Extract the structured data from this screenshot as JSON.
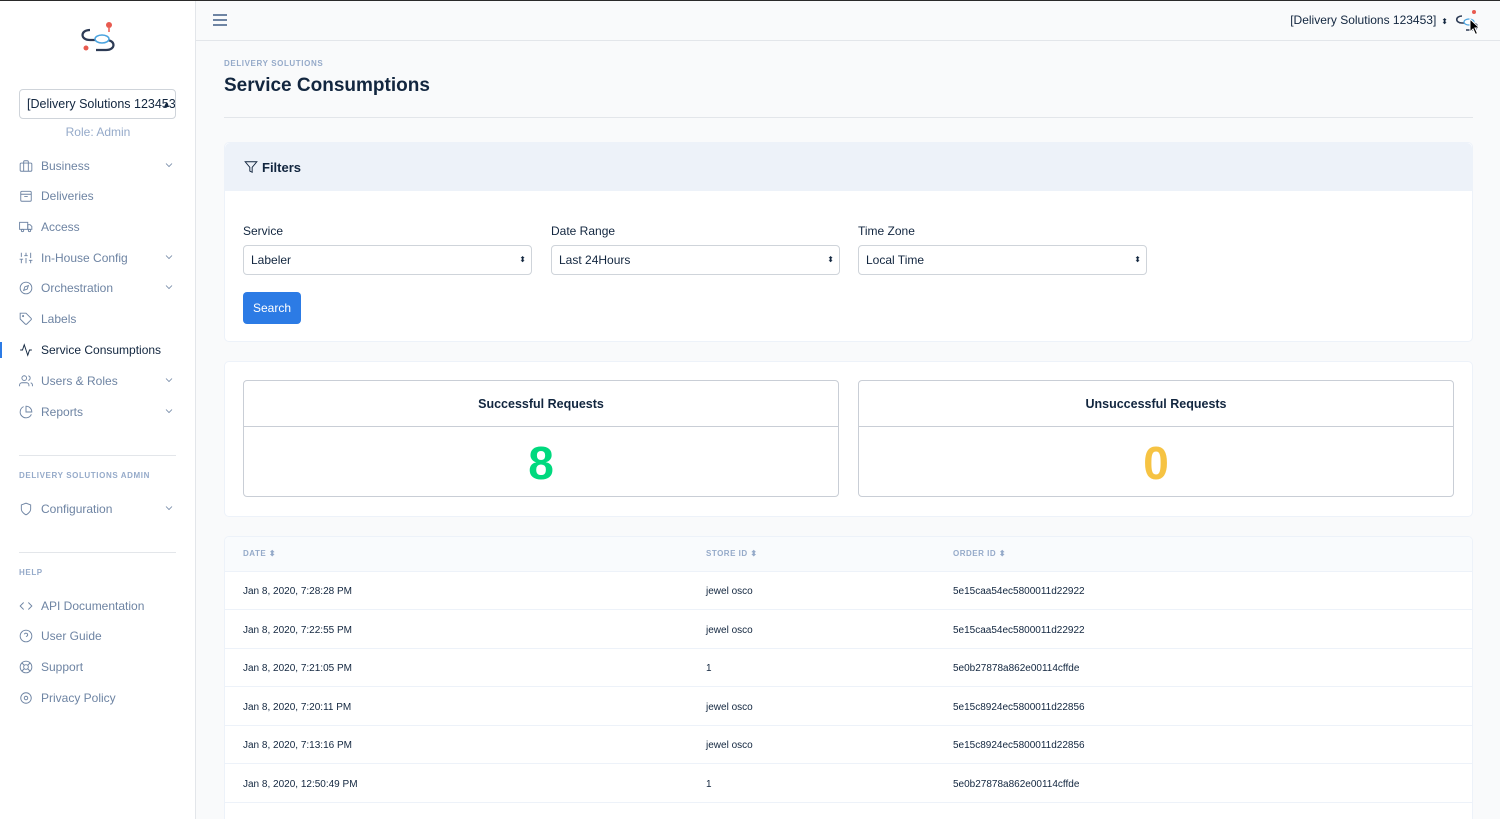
{
  "account_selector": {
    "value": "[Delivery Solutions 123453]"
  },
  "role": "Role: Admin",
  "nav": {
    "items": [
      {
        "label": "Business",
        "icon": "briefcase-icon",
        "chevron": true
      },
      {
        "label": "Deliveries",
        "icon": "package-icon",
        "chevron": false
      },
      {
        "label": "Access",
        "icon": "truck-icon",
        "chevron": false
      },
      {
        "label": "In-House Config",
        "icon": "sliders-icon",
        "chevron": true
      },
      {
        "label": "Orchestration",
        "icon": "compass-icon",
        "chevron": true
      },
      {
        "label": "Labels",
        "icon": "tag-icon",
        "chevron": false
      },
      {
        "label": "Service Consumptions",
        "icon": "activity-icon",
        "chevron": false,
        "active": true
      },
      {
        "label": "Users & Roles",
        "icon": "users-icon",
        "chevron": true
      },
      {
        "label": "Reports",
        "icon": "pie-chart-icon",
        "chevron": true
      }
    ],
    "admin_heading": "DELIVERY SOLUTIONS ADMIN",
    "admin_items": [
      {
        "label": "Configuration",
        "icon": "shield-icon",
        "chevron": true
      }
    ],
    "help_heading": "HELP",
    "help_items": [
      {
        "label": "API Documentation",
        "icon": "code-icon"
      },
      {
        "label": "User Guide",
        "icon": "help-circle-icon"
      },
      {
        "label": "Support",
        "icon": "life-buoy-icon"
      },
      {
        "label": "Privacy Policy",
        "icon": "settings-icon"
      }
    ]
  },
  "topbar": {
    "account": "[Delivery Solutions 123453]"
  },
  "header": {
    "pretitle": "DELIVERY SOLUTIONS",
    "title": "Service Consumptions"
  },
  "filters": {
    "title": "Filters",
    "service": {
      "label": "Service",
      "value": "Labeler"
    },
    "date_range": {
      "label": "Date Range",
      "value": "Last 24Hours"
    },
    "time_zone": {
      "label": "Time Zone",
      "value": "Local Time"
    },
    "search_label": "Search"
  },
  "stats": {
    "successful": {
      "label": "Successful Requests",
      "value": "8",
      "color": "#00d97e"
    },
    "unsuccessful": {
      "label": "Unsuccessful Requests",
      "value": "0",
      "color": "#f6c343"
    }
  },
  "table": {
    "columns": [
      "DATE",
      "STORE ID",
      "ORDER ID"
    ],
    "rows": [
      [
        "Jan 8, 2020, 7:28:28 PM",
        "jewel osco",
        "5e15caa54ec5800011d22922"
      ],
      [
        "Jan 8, 2020, 7:22:55 PM",
        "jewel osco",
        "5e15caa54ec5800011d22922"
      ],
      [
        "Jan 8, 2020, 7:21:05 PM",
        "1",
        "5e0b27878a862e00114cffde"
      ],
      [
        "Jan 8, 2020, 7:20:11 PM",
        "jewel osco",
        "5e15c8924ec5800011d22856"
      ],
      [
        "Jan 8, 2020, 7:13:16 PM",
        "jewel osco",
        "5e15c8924ec5800011d22856"
      ],
      [
        "Jan 8, 2020, 12:50:49 PM",
        "1",
        "5e0b27878a862e00114cffde"
      ]
    ]
  }
}
